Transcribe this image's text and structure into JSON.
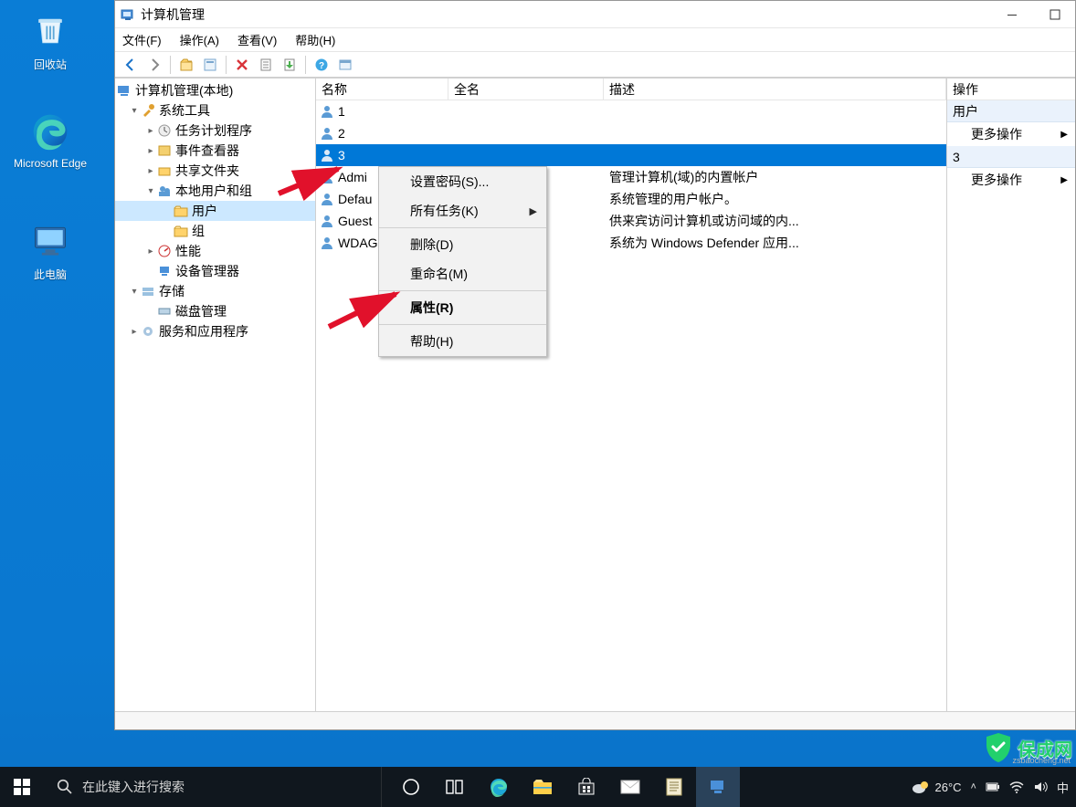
{
  "desktop": {
    "icons": [
      {
        "label": "回收站"
      },
      {
        "label": "Microsoft Edge"
      },
      {
        "label": "此电脑"
      }
    ]
  },
  "window": {
    "title": "计算机管理",
    "menubar": [
      "文件(F)",
      "操作(A)",
      "查看(V)",
      "帮助(H)"
    ],
    "tree": {
      "root": "计算机管理(本地)",
      "sys_tools": "系统工具",
      "task_sched": "任务计划程序",
      "event_viewer": "事件查看器",
      "shared": "共享文件夹",
      "local_users": "本地用户和组",
      "users": "用户",
      "groups": "组",
      "perf": "性能",
      "devmgr": "设备管理器",
      "storage": "存储",
      "diskmgr": "磁盘管理",
      "services": "服务和应用程序"
    },
    "columns": {
      "name": "名称",
      "full": "全名",
      "desc": "描述"
    },
    "rows": [
      {
        "name": "1",
        "full": "",
        "desc": ""
      },
      {
        "name": "2",
        "full": "",
        "desc": ""
      },
      {
        "name": "3",
        "full": "",
        "desc": ""
      },
      {
        "name": "Admi",
        "full": "",
        "desc": "管理计算机(域)的内置帐户"
      },
      {
        "name": "Defau",
        "full": "",
        "desc": "系统管理的用户帐户。"
      },
      {
        "name": "Guest",
        "full": "",
        "desc": "供来宾访问计算机或访问域的内..."
      },
      {
        "name": "WDAG",
        "full": "",
        "desc": "系统为 Windows Defender 应用..."
      }
    ],
    "actions": {
      "header": "操作",
      "section1": "用户",
      "item1": "更多操作",
      "section2": "3",
      "item2": "更多操作"
    },
    "context_menu": [
      {
        "label": "设置密码(S)...",
        "type": "item"
      },
      {
        "label": "所有任务(K)",
        "type": "submenu"
      },
      {
        "type": "sep"
      },
      {
        "label": "删除(D)",
        "type": "item"
      },
      {
        "label": "重命名(M)",
        "type": "item"
      },
      {
        "type": "sep"
      },
      {
        "label": "属性(R)",
        "type": "bold"
      },
      {
        "type": "sep"
      },
      {
        "label": "帮助(H)",
        "type": "item"
      }
    ]
  },
  "taskbar": {
    "search_placeholder": "在此键入进行搜索",
    "weather_temp": "26°C",
    "ime": "中"
  },
  "watermark": {
    "brand": "保成网",
    "sub": "zsbaocheng.net"
  }
}
